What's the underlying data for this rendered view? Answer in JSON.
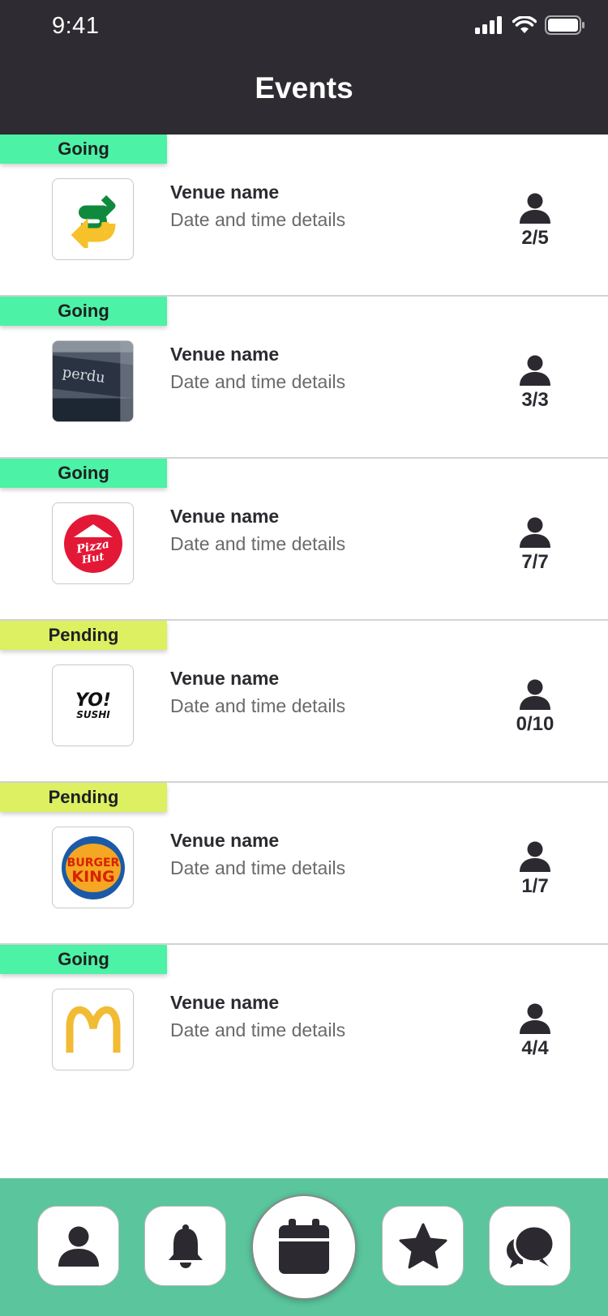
{
  "status_bar": {
    "time": "9:41"
  },
  "header": {
    "title": "Events"
  },
  "events": [
    {
      "status": "Going",
      "venue": "Venue name",
      "details": "Date and time details",
      "attendance": "2/5"
    },
    {
      "status": "Going",
      "venue": "Venue name",
      "details": "Date and time details",
      "attendance": "3/3"
    },
    {
      "status": "Going",
      "venue": "Venue name",
      "details": "Date and time details",
      "attendance": "7/7"
    },
    {
      "status": "Pending",
      "venue": "Venue name",
      "details": "Date and time details",
      "attendance": "0/10"
    },
    {
      "status": "Pending",
      "venue": "Venue name",
      "details": "Date and time details",
      "attendance": "1/7"
    },
    {
      "status": "Going",
      "venue": "Venue name",
      "details": "Date and time details",
      "attendance": "4/4"
    }
  ],
  "tabs": [
    "profile-icon",
    "bell-icon",
    "calendar-icon",
    "star-icon",
    "chat-icon"
  ],
  "colors": {
    "going": "#4cf2a5",
    "pending": "#dcf061",
    "header": "#2e2c32",
    "tabbar": "#5bc59d"
  }
}
